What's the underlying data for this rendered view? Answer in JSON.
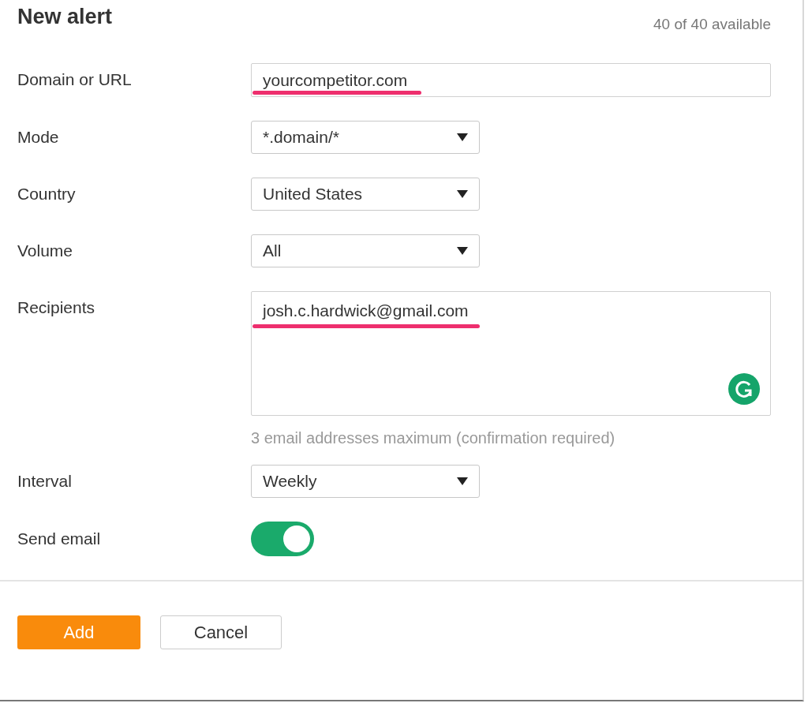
{
  "dialog": {
    "title": "New alert",
    "quota": "40 of 40 available"
  },
  "fields": [
    {
      "kind": "text",
      "label": "Domain or URL",
      "value": "yourcompetitor.com",
      "underlined": true
    },
    {
      "kind": "select",
      "label": "Mode",
      "value": "*.domain/*"
    },
    {
      "kind": "select",
      "label": "Country",
      "value": "United States"
    },
    {
      "kind": "select",
      "label": "Volume",
      "value": "All"
    },
    {
      "kind": "textarea",
      "label": "Recipients",
      "value": "josh.c.hardwick@gmail.com",
      "underlined": true,
      "hint": "3 email addresses maximum (confirmation required)"
    },
    {
      "kind": "select",
      "label": "Interval",
      "value": "Weekly"
    },
    {
      "kind": "toggle",
      "label": "Send email",
      "on": true
    }
  ],
  "buttons": [
    {
      "label": "Add",
      "kind": "primary"
    },
    {
      "label": "Cancel",
      "kind": "secondary"
    }
  ]
}
